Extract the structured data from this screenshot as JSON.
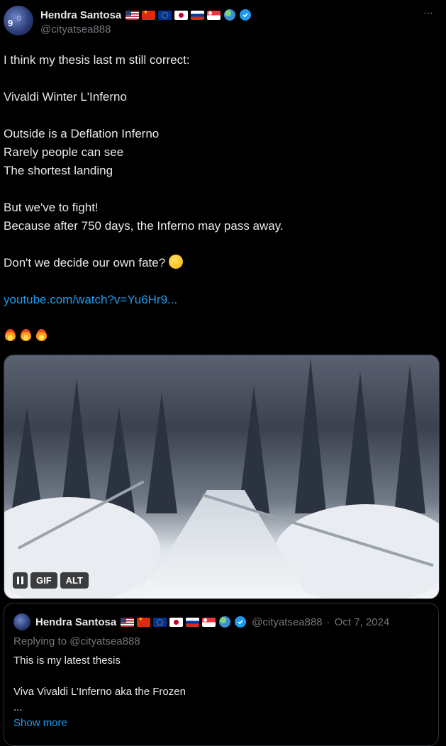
{
  "tweet": {
    "display_name": "Hendra Santosa",
    "handle": "@cityatsea888",
    "more_label": "···",
    "avatar_text": "9",
    "avatar_text_2": "0",
    "lines": [
      "I think my thesis last m still correct:",
      "",
      "Vivaldi Winter L'Inferno",
      "",
      "Outside is a Deflation Inferno",
      "Rarely people can see",
      "The shortest landing",
      "",
      "But we've to fight!",
      "Because after 750 days, the Inferno may pass away.",
      ""
    ],
    "fate_line": "Don't we decide our own fate?",
    "link": "youtube.com/watch?v=Yu6Hr9...",
    "emoji_count": 3,
    "colors": {
      "accent": "#1d9bf0",
      "text": "#e7e9ea",
      "muted": "#71767b",
      "background": "#000000"
    }
  },
  "media": {
    "gif_label": "GIF",
    "alt_label": "ALT"
  },
  "quoted": {
    "display_name": "Hendra Santosa",
    "handle": "@cityatsea888",
    "separator": "·",
    "date": "Oct 7, 2024",
    "replying_to": "Replying to @cityatsea888",
    "line1": "This is my latest thesis",
    "line2": "Viva Vivaldi L’Inferno aka the Frozen",
    "ellipsis": "...",
    "show_more": "Show more"
  }
}
